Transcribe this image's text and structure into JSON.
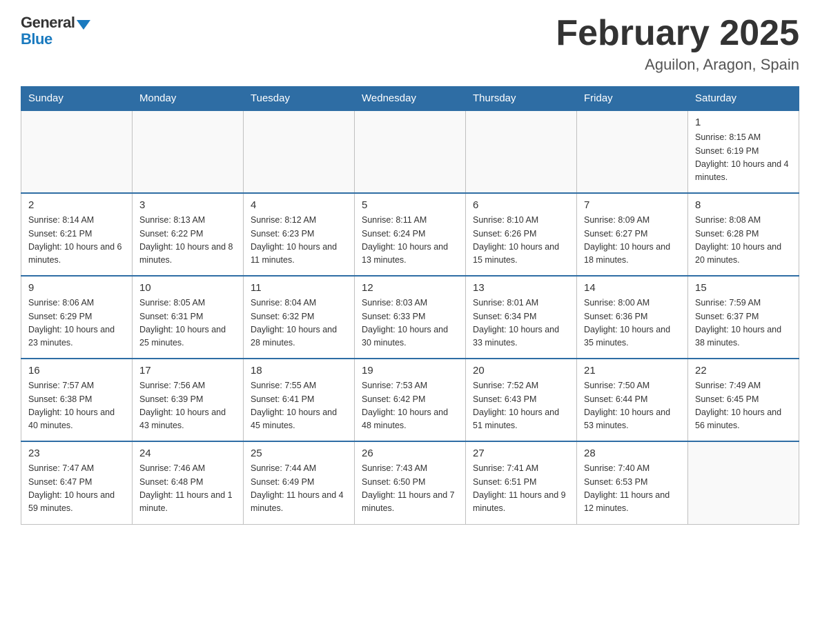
{
  "header": {
    "logo_general": "General",
    "logo_blue": "Blue",
    "month_title": "February 2025",
    "subtitle": "Aguilon, Aragon, Spain"
  },
  "weekdays": [
    "Sunday",
    "Monday",
    "Tuesday",
    "Wednesday",
    "Thursday",
    "Friday",
    "Saturday"
  ],
  "weeks": [
    [
      {
        "day": "",
        "info": ""
      },
      {
        "day": "",
        "info": ""
      },
      {
        "day": "",
        "info": ""
      },
      {
        "day": "",
        "info": ""
      },
      {
        "day": "",
        "info": ""
      },
      {
        "day": "",
        "info": ""
      },
      {
        "day": "1",
        "info": "Sunrise: 8:15 AM\nSunset: 6:19 PM\nDaylight: 10 hours and 4 minutes."
      }
    ],
    [
      {
        "day": "2",
        "info": "Sunrise: 8:14 AM\nSunset: 6:21 PM\nDaylight: 10 hours and 6 minutes."
      },
      {
        "day": "3",
        "info": "Sunrise: 8:13 AM\nSunset: 6:22 PM\nDaylight: 10 hours and 8 minutes."
      },
      {
        "day": "4",
        "info": "Sunrise: 8:12 AM\nSunset: 6:23 PM\nDaylight: 10 hours and 11 minutes."
      },
      {
        "day": "5",
        "info": "Sunrise: 8:11 AM\nSunset: 6:24 PM\nDaylight: 10 hours and 13 minutes."
      },
      {
        "day": "6",
        "info": "Sunrise: 8:10 AM\nSunset: 6:26 PM\nDaylight: 10 hours and 15 minutes."
      },
      {
        "day": "7",
        "info": "Sunrise: 8:09 AM\nSunset: 6:27 PM\nDaylight: 10 hours and 18 minutes."
      },
      {
        "day": "8",
        "info": "Sunrise: 8:08 AM\nSunset: 6:28 PM\nDaylight: 10 hours and 20 minutes."
      }
    ],
    [
      {
        "day": "9",
        "info": "Sunrise: 8:06 AM\nSunset: 6:29 PM\nDaylight: 10 hours and 23 minutes."
      },
      {
        "day": "10",
        "info": "Sunrise: 8:05 AM\nSunset: 6:31 PM\nDaylight: 10 hours and 25 minutes."
      },
      {
        "day": "11",
        "info": "Sunrise: 8:04 AM\nSunset: 6:32 PM\nDaylight: 10 hours and 28 minutes."
      },
      {
        "day": "12",
        "info": "Sunrise: 8:03 AM\nSunset: 6:33 PM\nDaylight: 10 hours and 30 minutes."
      },
      {
        "day": "13",
        "info": "Sunrise: 8:01 AM\nSunset: 6:34 PM\nDaylight: 10 hours and 33 minutes."
      },
      {
        "day": "14",
        "info": "Sunrise: 8:00 AM\nSunset: 6:36 PM\nDaylight: 10 hours and 35 minutes."
      },
      {
        "day": "15",
        "info": "Sunrise: 7:59 AM\nSunset: 6:37 PM\nDaylight: 10 hours and 38 minutes."
      }
    ],
    [
      {
        "day": "16",
        "info": "Sunrise: 7:57 AM\nSunset: 6:38 PM\nDaylight: 10 hours and 40 minutes."
      },
      {
        "day": "17",
        "info": "Sunrise: 7:56 AM\nSunset: 6:39 PM\nDaylight: 10 hours and 43 minutes."
      },
      {
        "day": "18",
        "info": "Sunrise: 7:55 AM\nSunset: 6:41 PM\nDaylight: 10 hours and 45 minutes."
      },
      {
        "day": "19",
        "info": "Sunrise: 7:53 AM\nSunset: 6:42 PM\nDaylight: 10 hours and 48 minutes."
      },
      {
        "day": "20",
        "info": "Sunrise: 7:52 AM\nSunset: 6:43 PM\nDaylight: 10 hours and 51 minutes."
      },
      {
        "day": "21",
        "info": "Sunrise: 7:50 AM\nSunset: 6:44 PM\nDaylight: 10 hours and 53 minutes."
      },
      {
        "day": "22",
        "info": "Sunrise: 7:49 AM\nSunset: 6:45 PM\nDaylight: 10 hours and 56 minutes."
      }
    ],
    [
      {
        "day": "23",
        "info": "Sunrise: 7:47 AM\nSunset: 6:47 PM\nDaylight: 10 hours and 59 minutes."
      },
      {
        "day": "24",
        "info": "Sunrise: 7:46 AM\nSunset: 6:48 PM\nDaylight: 11 hours and 1 minute."
      },
      {
        "day": "25",
        "info": "Sunrise: 7:44 AM\nSunset: 6:49 PM\nDaylight: 11 hours and 4 minutes."
      },
      {
        "day": "26",
        "info": "Sunrise: 7:43 AM\nSunset: 6:50 PM\nDaylight: 11 hours and 7 minutes."
      },
      {
        "day": "27",
        "info": "Sunrise: 7:41 AM\nSunset: 6:51 PM\nDaylight: 11 hours and 9 minutes."
      },
      {
        "day": "28",
        "info": "Sunrise: 7:40 AM\nSunset: 6:53 PM\nDaylight: 11 hours and 12 minutes."
      },
      {
        "day": "",
        "info": ""
      }
    ]
  ]
}
